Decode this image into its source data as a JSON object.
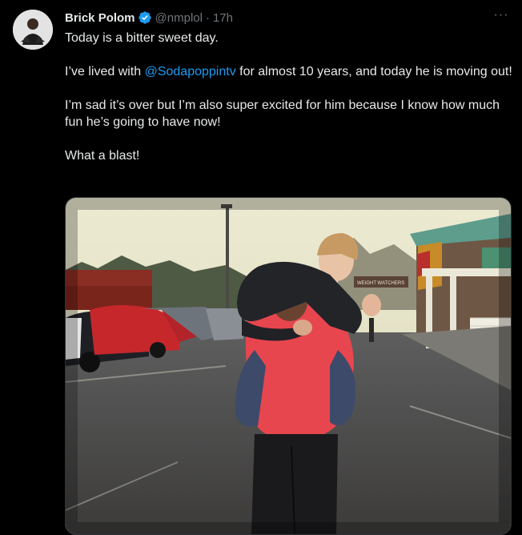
{
  "author": {
    "name": "Brick Polom",
    "handle": "@nmplol",
    "separator": "·",
    "time": "17h"
  },
  "menu": {
    "more_glyph": "···"
  },
  "tweet": {
    "line1": "Today is a bitter sweet day.",
    "line2_before": "I’ve lived with ",
    "line2_mention": "@Sodapoppintv",
    "line2_after": " for almost 10 years, and today he is moving out!",
    "line3": "I’m sad it’s over but I’m also super excited for him because I know how much fun he’s going to have now!",
    "line4": "What a blast!"
  },
  "photo": {
    "store_sign": "WEIGHT WATCHERS"
  },
  "colors": {
    "background": "#000000",
    "text": "#e7e9ea",
    "muted": "#71767b",
    "link": "#1d9bf0",
    "verified": "#1d9bf0"
  },
  "icons": [
    "verified-badge-icon",
    "more-options-icon"
  ]
}
